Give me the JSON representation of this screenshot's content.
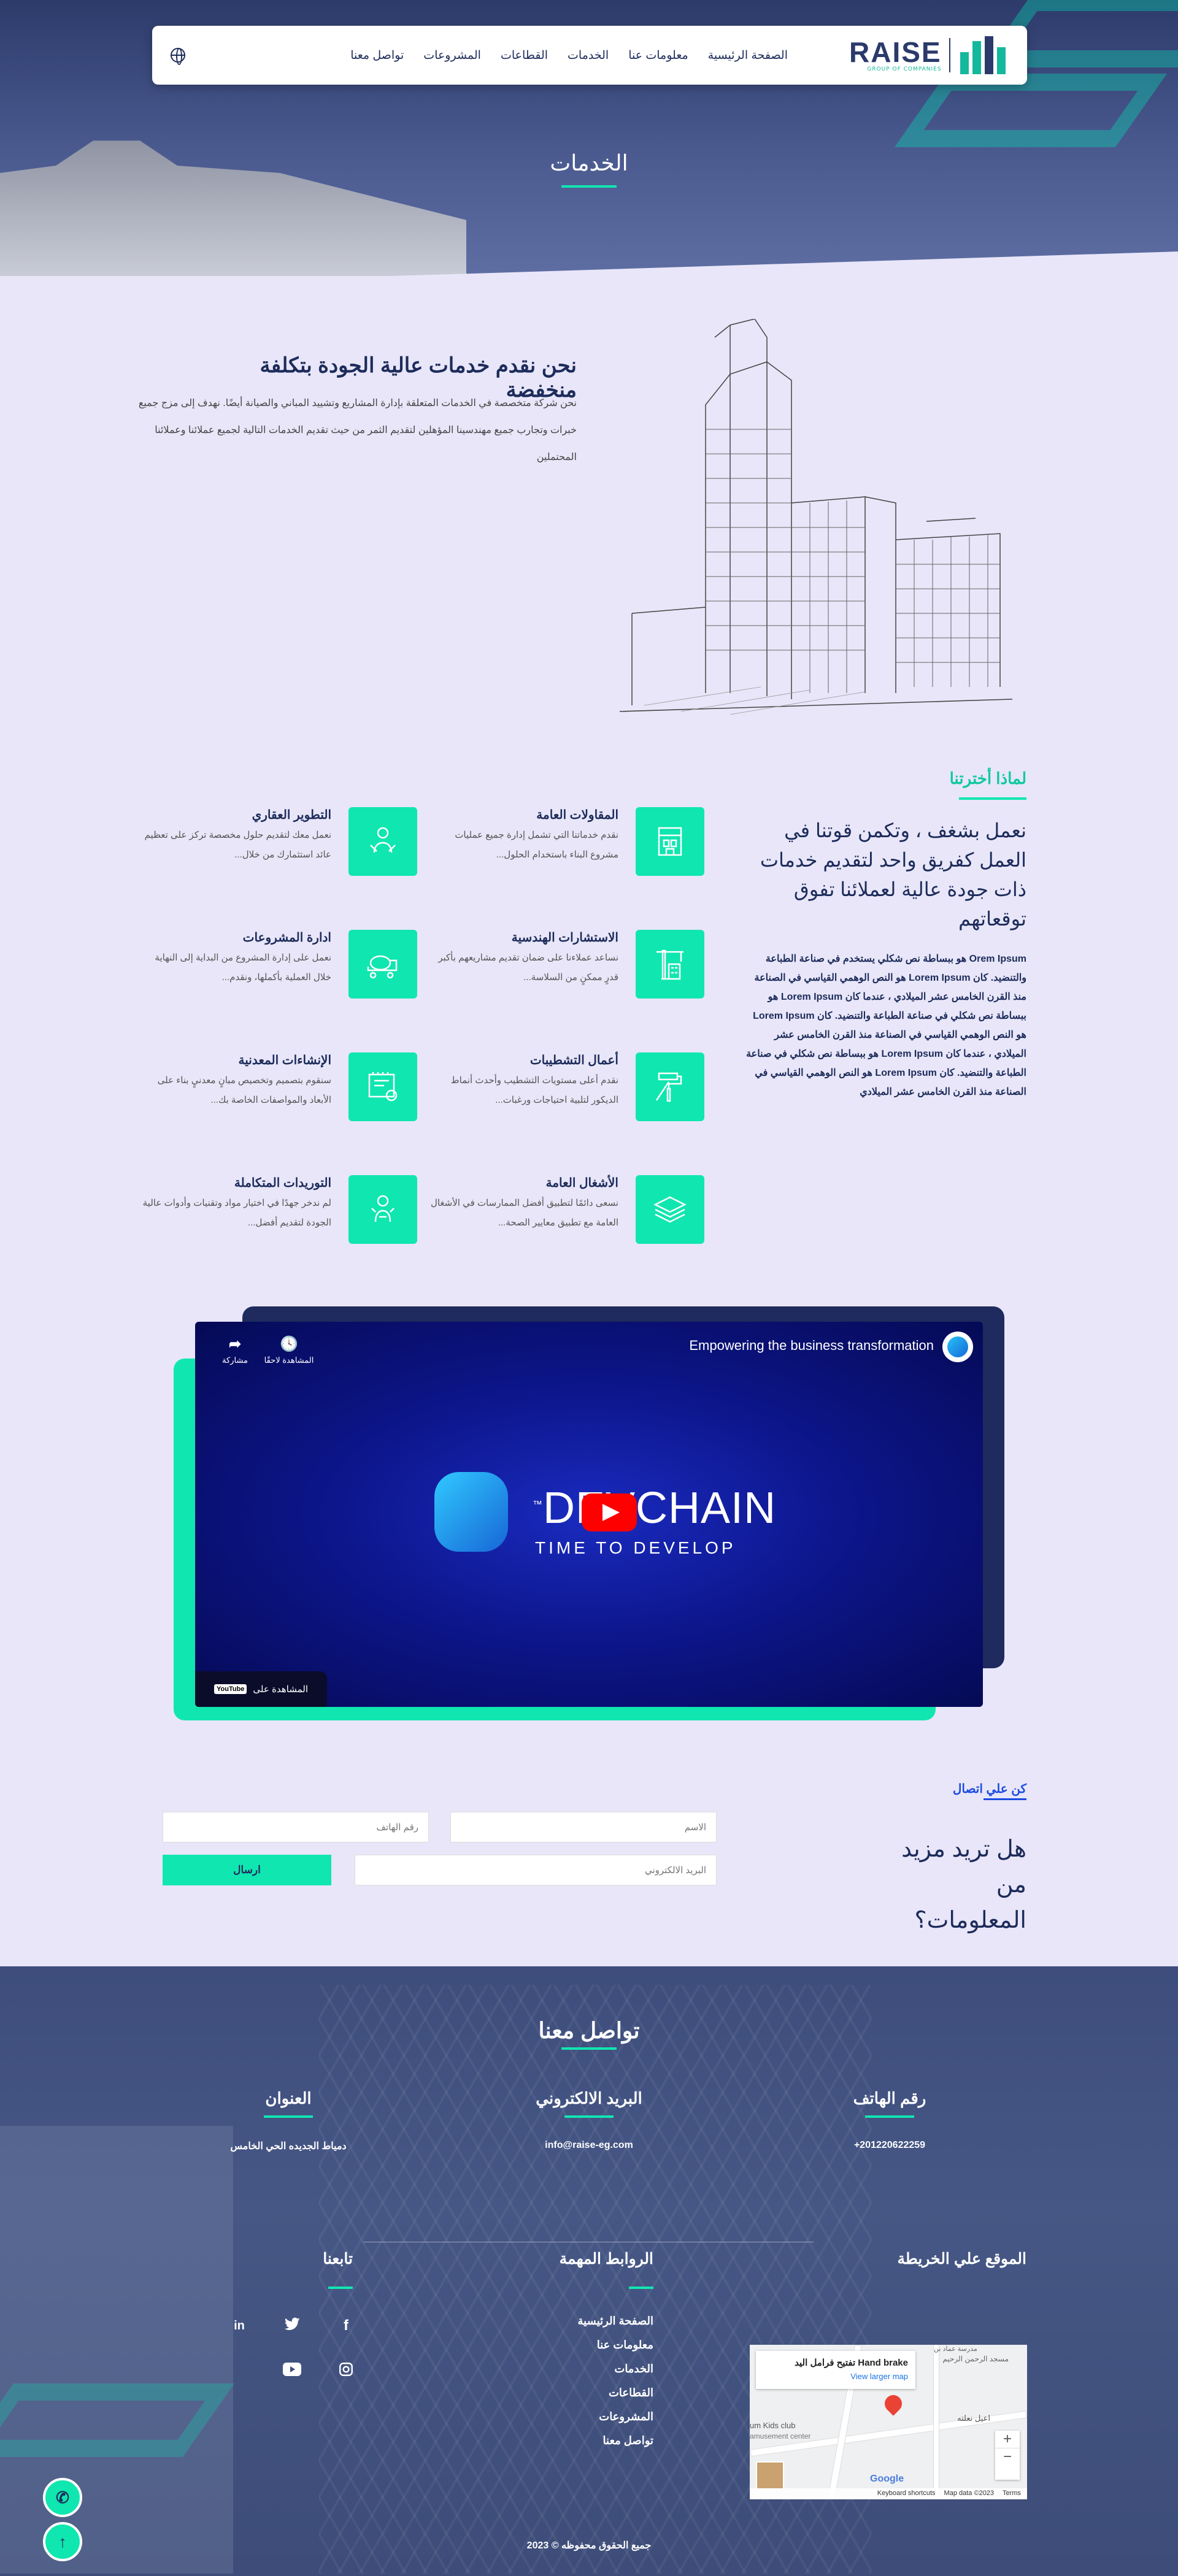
{
  "nav": {
    "logo_text": "RAISE",
    "logo_tagline": "GROUP OF COMPANIES",
    "items": [
      "الصفحة الرئيسية",
      "معلومات عنا",
      "الخدمات",
      "القطاعات",
      "المشروعات",
      "تواصل معنا"
    ]
  },
  "page_title": "الخدمات",
  "intro": {
    "title": "نحن نقدم خدمات عالية الجودة بتكلفة منخفضة",
    "text": "نحن شركة متخصصة في الخدمات المتعلقة بإدارة المشاريع وتشييد المباني والصيانة أيضًا. نهدف إلى مزج جميع خبرات وتجارب جميع مهندسينا المؤهلين لتقديم الثمر من حيث تقديم الخدمات التالية لجميع عملائنا وعملائنا المحتملين"
  },
  "why": {
    "subtitle": "لماذا أخترتنا",
    "heading": "نعمل بشغف ، وتكمن قوتنا في العمل كفريق واحد لتقديم خدمات ذات جودة عالية لعملائنا تفوق توقعاتهم",
    "paragraph": "Orem Ipsum هو ببساطة نص شكلي يستخدم في صناعة الطباعة والتنضيد. كان Lorem Ipsum هو النص الوهمي القياسي في الصناعة منذ القرن الخامس عشر الميلادي ، عندما كان Lorem Ipsum هو ببساطة نص شكلي في صناعة الطباعة والتنضيد. كان Lorem Ipsum هو النص الوهمي القياسي في الصناعة منذ القرن الخامس عشر الميلادي ، عندما كان Lorem Ipsum هو ببساطة نص شكلي في صناعة الطباعة والتنضيد. كان Lorem Ipsum هو النص الوهمي القياسي في الصناعة منذ القرن الخامس عشر الميلادي"
  },
  "services": [
    {
      "title": "المقاولات العامة",
      "desc": "نقدم خدماتنا التي تشمل إدارة جميع عمليات مشروع البناء باستخدام الحلول...",
      "icon": "contracting-icon"
    },
    {
      "title": "التطوير العقاري",
      "desc": "نعمل معك لتقديم حلول مخصصة تركز على تعظيم عائد استثمارك من خلال...",
      "icon": "real-estate-icon"
    },
    {
      "title": "الاستشارات الهندسية",
      "desc": "نساعد عملاءنا على ضمان تقديم مشاريعهم بأكبر قدرٍ ممكنٍ من السلاسة...",
      "icon": "crane-icon"
    },
    {
      "title": "ادارة المشروعات",
      "desc": "نعمل على إدارة المشروع من البداية إلى النهاية خلال العملية بأكملها، ونقدم...",
      "icon": "mixer-truck-icon"
    },
    {
      "title": "أعمال التشطيبات",
      "desc": "نقدم أعلى مستويات التشطيب وأحدث أنماط الديكور لتلبية احتياجات ورغبات...",
      "icon": "paint-roller-icon"
    },
    {
      "title": "الإنشاءات المعدنية",
      "desc": "سنقوم بتصميم وتخصيص مبانٍ معدنيٍ بناء على الأبعاد والمواصفات الخاصة بك...",
      "icon": "blueprint-icon"
    },
    {
      "title": "الأشغال العامة",
      "desc": "نسعى دائمًا لتطبيق أفضل الممارسات في الأشغال العامة مع تطبيق معايير الصحة...",
      "icon": "layers-icon"
    },
    {
      "title": "التوريدات المتكاملة",
      "desc": "لم ندخر جهدًا في اختيار مواد وتقنيات وأدوات عالية الجودة لتقديم أفضل...",
      "icon": "supply-icon"
    }
  ],
  "video": {
    "title": "Empowering the business transformation",
    "share": "مشاركة",
    "watch_later": "المشاهدة لاحقًا",
    "brand": "DEVCHAIN",
    "brand_tm": "™",
    "tagline": "TIME TO DEVELOP",
    "watch_on": "المشاهدة على",
    "youtube": "YouTube"
  },
  "contact_form": {
    "subtitle": "كن علي اتصال",
    "heading": "هل تريد مزيد من المعلومات؟",
    "name_placeholder": "الاسم",
    "phone_placeholder": "رقم الهاتف",
    "email_placeholder": "البريد الالكتروني",
    "submit": "ارسال"
  },
  "footer": {
    "title": "تواصل معنا",
    "phone_label": "رقم الهاتف",
    "phone": "+201220622259",
    "email_label": "البريد الالكتروني",
    "email": "info@raise-eg.com",
    "address_label": "العنوان",
    "address": "دمياط الجديده الحي الخامس",
    "map_title": "الموقع علي الخريطة",
    "links_title": "الروابط المهمة",
    "links": [
      "الصفحة الرئيسية",
      "معلومات عنا",
      "الخدمات",
      "القطاعات",
      "المشروعات",
      "تواصل معنا"
    ],
    "follow_title": "تابعنا",
    "social": [
      "facebook-icon",
      "twitter-icon",
      "linkedin-icon",
      "instagram-icon",
      "youtube-icon"
    ],
    "copyright": "جميع الحقوق محفوظه © 2023"
  },
  "map": {
    "place": "Hand brake تفتيح فرامل اليد",
    "larger": "View larger map",
    "label_1": "مسجد الرحمن الرحيم",
    "label_2": "مدرسة عماد بن",
    "label_3": "um Kids club",
    "label_4": "amusement center",
    "label_5": "اعيل نعلته",
    "google": "Google",
    "shortcuts": "Keyboard shortcuts",
    "mapdata": "Map data ©2023",
    "terms": "Terms"
  },
  "colors": {
    "accent": "#10e6b0",
    "navy": "#1c2b5a",
    "blue": "#1c4be0"
  }
}
